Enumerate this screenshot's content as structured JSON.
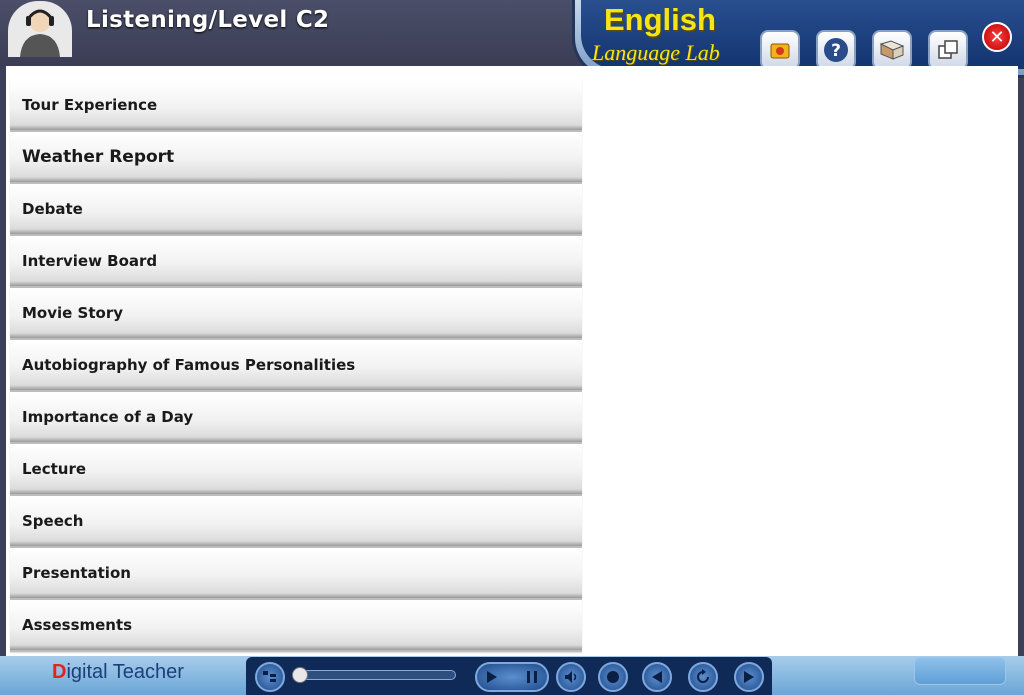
{
  "header": {
    "title": "Listening/Level C2",
    "brand_title": "English",
    "brand_subtitle": "Language Lab",
    "toolbar": [
      {
        "name": "record-icon"
      },
      {
        "name": "help-icon",
        "glyph": "?"
      },
      {
        "name": "book-icon"
      },
      {
        "name": "windows-icon"
      }
    ],
    "close_glyph": "✕"
  },
  "topics": [
    {
      "label": "Tour Experience"
    },
    {
      "label": "Weather Report"
    },
    {
      "label": "Debate"
    },
    {
      "label": "Interview Board"
    },
    {
      "label": "Movie Story"
    },
    {
      "label": "Autobiography of Famous Personalities"
    },
    {
      "label": "Importance of a Day"
    },
    {
      "label": "Lecture"
    },
    {
      "label": "Speech"
    },
    {
      "label": "Presentation"
    },
    {
      "label": "Assessments"
    }
  ],
  "footer": {
    "logo_d": "D",
    "logo_rest": "igital Teacher",
    "controls": [
      "play-icon",
      "pause-icon",
      "volume-icon",
      "stop-icon",
      "previous-icon",
      "replay-icon",
      "next-icon"
    ],
    "playback_progress": 0
  },
  "colors": {
    "brand_yellow": "#f5e515",
    "header_bg": "#3a3d54",
    "panel_blue": "#12346f",
    "close_red": "#d00000"
  }
}
